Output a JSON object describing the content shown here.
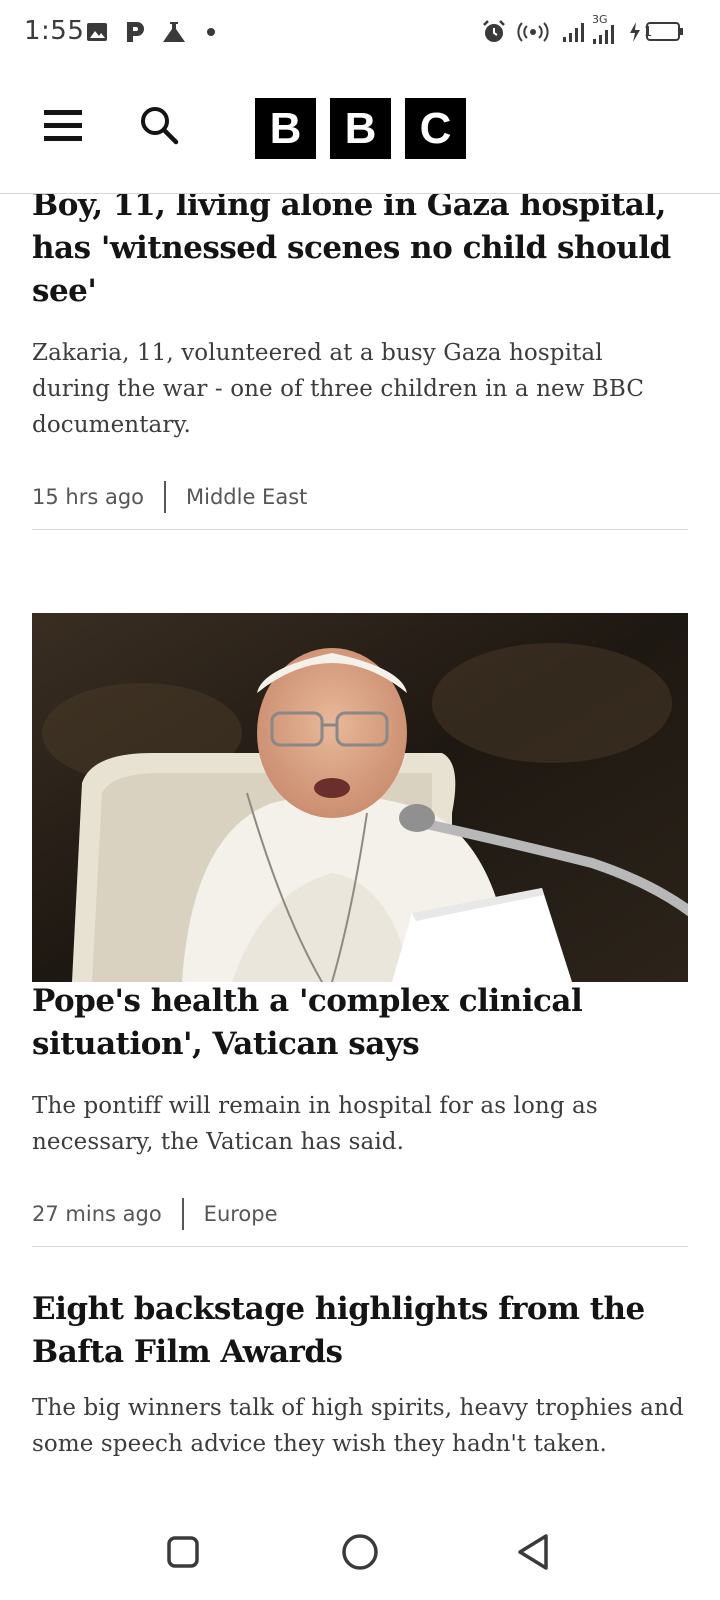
{
  "status_bar": {
    "time": "1:55",
    "network_label": "3G",
    "battery_level": "1",
    "icons": [
      "image-icon",
      "p-app-icon",
      "flask-icon",
      "dot-icon",
      "alarm-icon",
      "hotspot-icon",
      "signal-icon",
      "signal-3g-icon",
      "charging-icon",
      "battery-icon"
    ]
  },
  "header": {
    "logo_letters": [
      "B",
      "B",
      "C"
    ],
    "icons": [
      "menu-icon",
      "search-icon"
    ]
  },
  "articles": [
    {
      "headline": "Boy, 11, living alone in Gaza hospital, has 'witnessed scenes no child should see'",
      "summary": "Zakaria, 11, volunteered at a busy Gaza hospital during the war - one of three children in a new BBC documentary.",
      "time": "15 hrs ago",
      "section": "Middle East"
    },
    {
      "headline": "Pope's health a 'complex clinical situation', Vatican says",
      "summary": "The pontiff will remain in hospital for as long as necessary, the Vatican has said.",
      "time": "27 mins ago",
      "section": "Europe"
    },
    {
      "headline": "Eight backstage highlights from the Bafta Film Awards",
      "summary": "The big winners talk of high spirits, heavy trophies and some speech advice they wish they hadn't taken."
    }
  ],
  "nav_bar": {
    "icons": [
      "recent-apps-icon",
      "home-icon",
      "back-icon"
    ]
  },
  "colors": {
    "text": "#141414",
    "summary": "#3c3c3c",
    "meta": "#545658",
    "logo_bg": "#000000"
  }
}
